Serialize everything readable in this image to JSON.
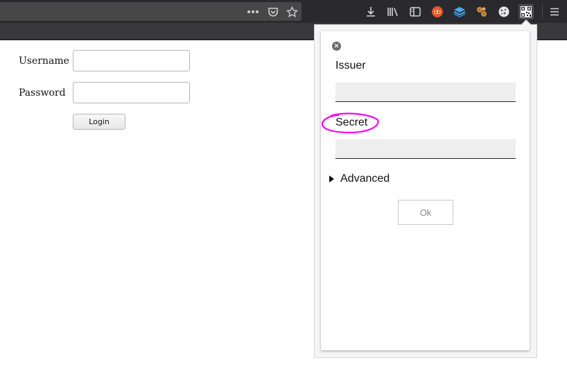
{
  "login_form": {
    "username_label": "Username",
    "password_label": "Password",
    "login_button": "Login"
  },
  "popup": {
    "issuer_label": "Issuer",
    "secret_label": "Secret",
    "advanced_label": "Advanced",
    "ok_button": "Ok"
  },
  "colors": {
    "highlight": "#ff00ff",
    "toolbar_bg": "#2a2a2e"
  }
}
